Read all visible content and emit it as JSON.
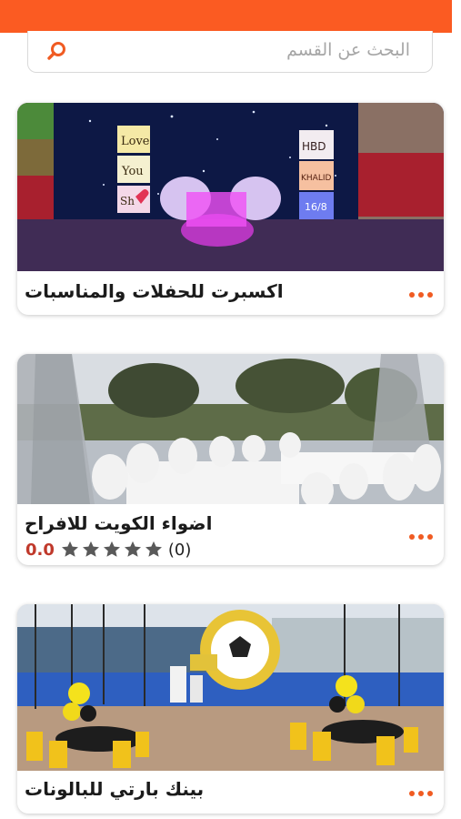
{
  "header": {
    "color": "#fb5b22"
  },
  "search": {
    "placeholder": "البحث عن القسم",
    "icon": "search-icon"
  },
  "listings": [
    {
      "title": "اكسبرت للحفلات والمناسبات",
      "photo_text": [
        "Love",
        "You",
        "Sh",
        "HBD",
        "KHALID",
        "16/8"
      ]
    },
    {
      "title": "اضواء الكويت للافراح",
      "rating": {
        "score": "0.0",
        "stars": 5,
        "filled": 0,
        "count": "(0)"
      }
    },
    {
      "title": "بينك بارتي للبالونات"
    }
  ],
  "more_icon": "more-dots-icon"
}
